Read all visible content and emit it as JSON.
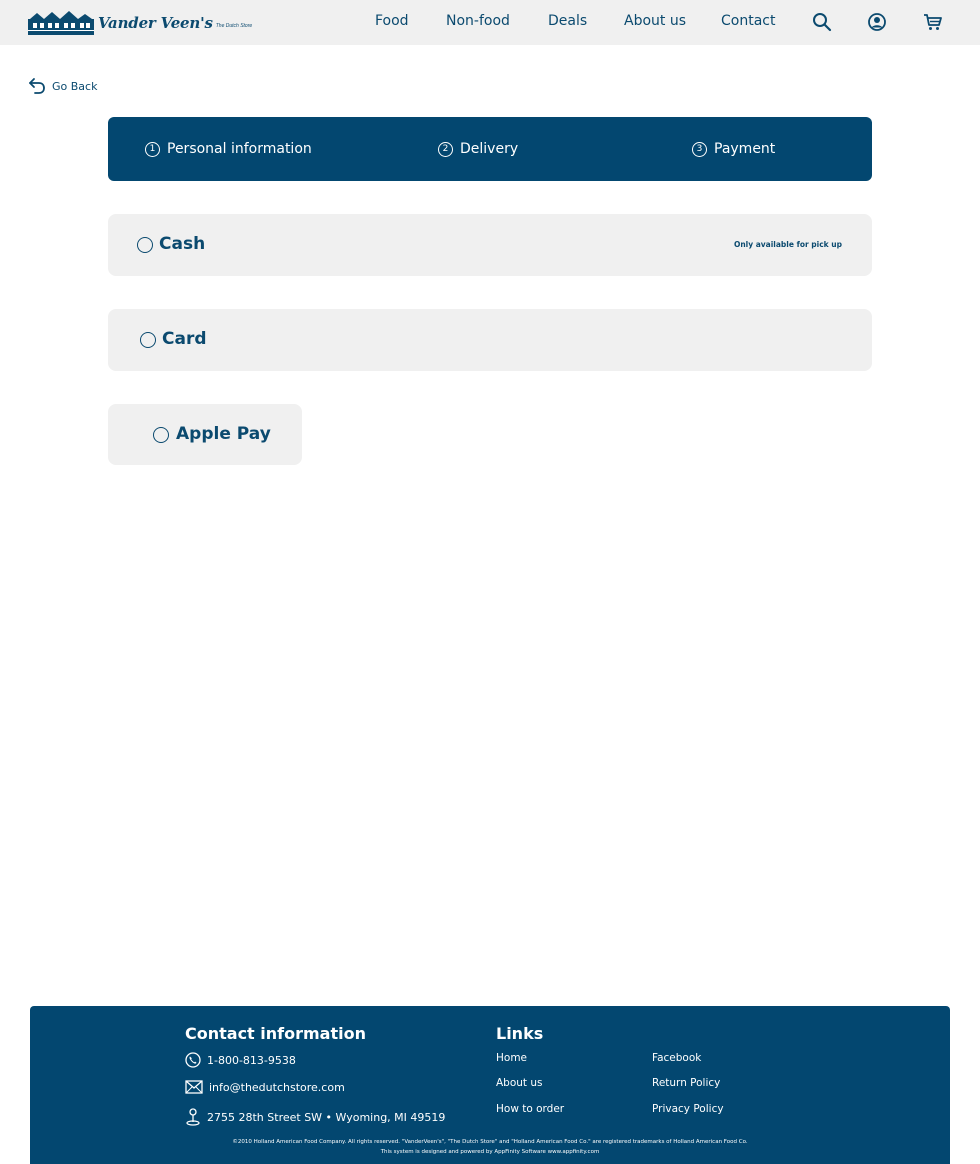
{
  "header": {
    "logo_text": "Vander Veen's",
    "logo_tagline": "The Dutch Store",
    "nav": [
      {
        "label": "Food"
      },
      {
        "label": "Non-food"
      },
      {
        "label": "Deals"
      },
      {
        "label": "About us"
      },
      {
        "label": "Contact"
      }
    ],
    "icons": [
      "search-icon",
      "account-icon",
      "cart-icon"
    ]
  },
  "go_back": {
    "label": "Go Back"
  },
  "steps": [
    {
      "num": "1",
      "label": "Personal information"
    },
    {
      "num": "2",
      "label": "Delivery"
    },
    {
      "num": "3",
      "label": "Payment"
    }
  ],
  "payment_options": [
    {
      "label": "Cash",
      "note": "Only available for pick up"
    },
    {
      "label": "Card"
    },
    {
      "label": "Apple Pay"
    }
  ],
  "footer": {
    "contact_heading": "Contact information",
    "phone": "1-800-813-9538",
    "email": "info@thedutchstore.com",
    "address": "2755 28th Street SW • Wyoming, MI 49519",
    "links_heading": "Links",
    "links_col1": [
      "Home",
      "About us",
      "How to order"
    ],
    "links_col2": [
      "Facebook",
      "Return Policy",
      "Privacy Policy"
    ],
    "copyright": "©2010 Holland American Food Company. All rights reserved. \"VanderVeen's\", \"The Dutch Store\" and \"Holland American Food Co.\" are registered trademarks of Holland American Food Co.",
    "powered_by": "This system is designed and powered by AppFinity Software www.appfinity.com"
  },
  "colors": {
    "brand": "#034770",
    "text": "#0b4a6f",
    "panel": "#f0f0f0"
  }
}
